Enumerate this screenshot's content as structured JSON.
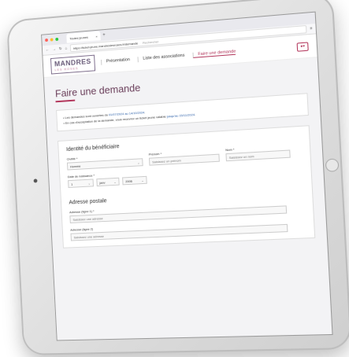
{
  "browser": {
    "tab_title": "Toutes jeunes",
    "tab_close": "×",
    "new_tab": "+",
    "url": "https://ticket-jeune.mandreslesroses.fr/demande",
    "search_placeholder": "Rechercher"
  },
  "site": {
    "logo_main": "MANDRES",
    "logo_sub": "LES ROSES",
    "nav": [
      "Présentation",
      "Liste des associations",
      "Faire une demande"
    ],
    "user_button": "●▾"
  },
  "page": {
    "title": "Faire une demande",
    "notice_line1_pre": "Les demandes sont ouvertes du ",
    "notice_line1_dates": "01/07/2024 au 14/10/2024",
    "notice_line2_pre": "En cas d'acceptation de la demande, vous recevrez un ticket jeune valable ",
    "notice_line2_dates": "jusqu'au 15/11/2024"
  },
  "beneficiary": {
    "heading": "Identité du bénéficiaire",
    "civility_label": "Civilité *",
    "civility_value": "Homme",
    "firstname_label": "Prénom *",
    "firstname_placeholder": "Saisissez un prénom",
    "name_label": "Nom *",
    "name_placeholder": "Saisissez un nom",
    "birth_label": "Date de naissance *",
    "birth_day": "1",
    "birth_month": "janv",
    "birth_year": "2006"
  },
  "address": {
    "heading": "Adresse postale",
    "line1_label": "Adresse (ligne 1) *",
    "line1_placeholder": "Saisissez une adresse",
    "line2_label": "Adresse (ligne 2)",
    "line2_placeholder": "Saisissez une adresse"
  },
  "colors": {
    "accent": "#b2345a",
    "title": "#6a3e5a"
  }
}
